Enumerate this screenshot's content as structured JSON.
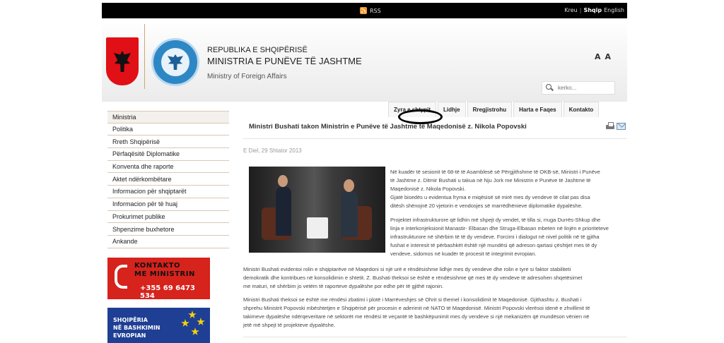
{
  "topbar": {
    "rss": "RSS",
    "home": "Kreu",
    "sep": "|",
    "lang_active": "Shqip",
    "lang_other": "English"
  },
  "header": {
    "line1": "REPUBLIKA E SHQIPËRISË",
    "line2": "MINISTRIA E PUNËVE TË JASHTME",
    "line3": "Ministry of Foreign Affairs",
    "font_size_a": "A",
    "font_size_b": "A"
  },
  "search": {
    "placeholder": "kerko..."
  },
  "nav": [
    "Zyra e shtypit",
    "Lidhje",
    "Rregjistrohu",
    "Harta e Faqes",
    "Kontakto"
  ],
  "sidebar": {
    "items": [
      "Ministria",
      "Politika",
      "Rreth Shqipërisë",
      "Përfaqësitë Diplomatike",
      "Konventa dhe raporte",
      "Aktet ndërkombëtare",
      "Informacion për shqiptarët",
      "Informacion për të huaj",
      "Prokurimet publike",
      "Shpenzime buxhetore",
      "Ankande"
    ]
  },
  "banner_contact": {
    "l1": "KONTAKTO",
    "l2": "ME MINISTRIN",
    "phone": "+355 69 6473 534"
  },
  "banner_eu": {
    "l1": "SHQIPËRIA",
    "l2": "NË BASHKIMIN",
    "l3": "EVROPIAN"
  },
  "article": {
    "title": "Ministri Bushati takon Ministrin e Punëve të Jashtme të Maqedonisë z. Nikola Popovski",
    "date": "E Diel, 29 Shtator 2013",
    "p1": [
      "Në kuadër të sesionit të 68-të të Asamblesë së Përgjithshme të OKB-së, Ministri i Punëve",
      "të Jashtme z. Ditmir Bushati u takua në Nju Jork me Ministrin e Punëve të Jashtme të",
      "Maqedonisë z. Nikola Popovski."
    ],
    "p2": [
      "Gjatë bisedës u evidentua fryma e miqësisë së mirë mes dy vendeve të cilat pas disa",
      "ditësh shënojnë 20 vjetorin e vendosjes së marrëdhënieve diplomatike dypalëshe."
    ],
    "p3": [
      "Projektet infrastrukturore që lidhin më shpejt dy vendet, të tilla si, rruga Durrës-Shkup dhe",
      "linja e interkonjeksionit Manastir- Elbasan dhe Struga-Elbasan mbeten në linjën e prioriteteve",
      "infrastrukturore në shërbim të të dy vendeve. Forcimi i dialogut në nivel politik në të gjitha",
      "fushat e interesit të përbashkët është një mundësi që adreson qartasi çështjet mes të dy",
      "vendeve, sidomos në kuadër të procesit të integrimit evropian."
    ],
    "p4": [
      "Ministri Bushati evidentoi rolin e shqiptarëve në Maqedoni si një urë e rëndësishme lidhje mes dy vendeve dhe rolin e tyre si faktor stabiliteti",
      "demokratik dhe kontribues në konsolidimin e shtetit. Z. Bushati theksoi se është e rëndësishme që mes të dy vendeve të adresohen shqetësimet",
      "me maturi, në shërbim jo vetëm të raporteve dypalëshe por edhe për të gjithë rajonin."
    ],
    "p5": [
      "Ministri Bushati theksoi se është me rëndësi  zbatimi i plotë i Marrëveshjes së Ohrit si themel i konsolidimit të Maqedonisë. Gjithashtu z. Bushati i",
      "shprehu Ministrit Popovski mbështetjen e Shqipërisë për procesin e aderimit në NATO të Maqedonisë. Ministri Popovski vlerësoi idenë e zhvillimit të",
      "takimeve dypalëshe ndërqeveritare në sektorët me rëndësi të veçantë të bashkëpunimit mes dy vendeve si një mekanizëm që mundëson vënien në",
      "jetë më shpejt të projekteve dypalëshe."
    ]
  },
  "colors": {
    "flag_red": "#e10f16",
    "seal_blue": "#2e87c5",
    "banner_red": "#d6231c",
    "banner_blue": "#1f3f94"
  }
}
